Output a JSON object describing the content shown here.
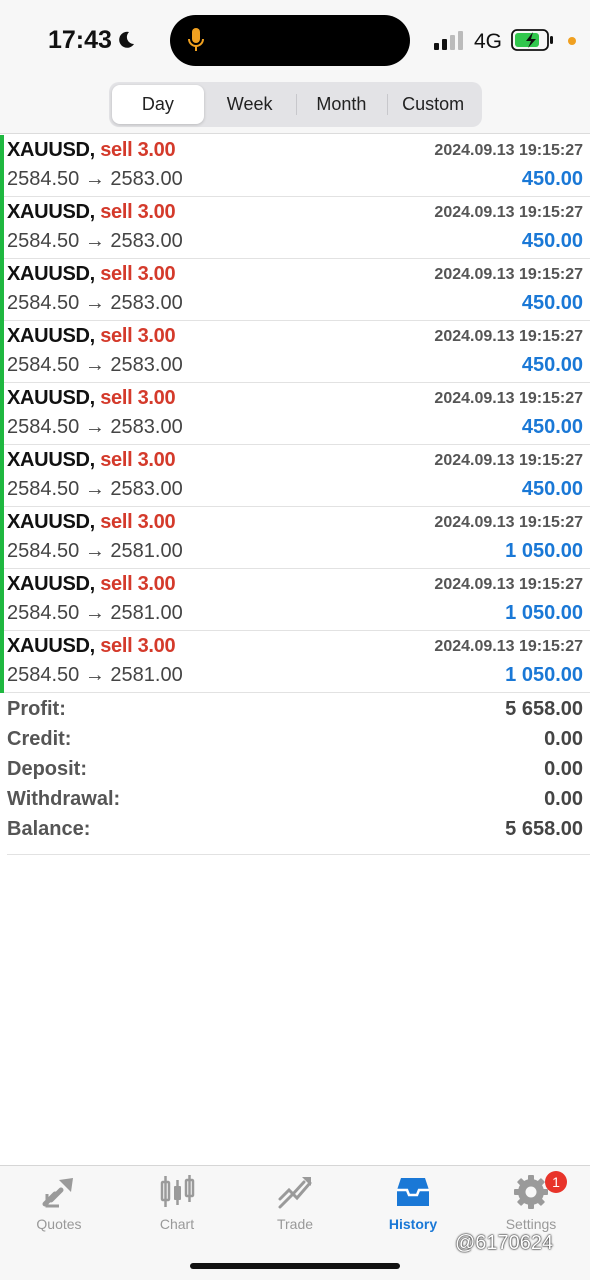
{
  "status": {
    "time": "17:43",
    "network": "4G"
  },
  "periods": [
    {
      "label": "Day",
      "active": true
    },
    {
      "label": "Week",
      "active": false
    },
    {
      "label": "Month",
      "active": false
    },
    {
      "label": "Custom",
      "active": false
    }
  ],
  "deals": [
    {
      "symbol": "XAUUSD,",
      "side": "sell 3.00",
      "time": "2024.09.13 19:15:27",
      "prices": "2584.50 → 2583.00",
      "profit": "450.00"
    },
    {
      "symbol": "XAUUSD,",
      "side": "sell 3.00",
      "time": "2024.09.13 19:15:27",
      "prices": "2584.50 → 2583.00",
      "profit": "450.00"
    },
    {
      "symbol": "XAUUSD,",
      "side": "sell 3.00",
      "time": "2024.09.13 19:15:27",
      "prices": "2584.50 → 2583.00",
      "profit": "450.00"
    },
    {
      "symbol": "XAUUSD,",
      "side": "sell 3.00",
      "time": "2024.09.13 19:15:27",
      "prices": "2584.50 → 2583.00",
      "profit": "450.00"
    },
    {
      "symbol": "XAUUSD,",
      "side": "sell 3.00",
      "time": "2024.09.13 19:15:27",
      "prices": "2584.50 → 2583.00",
      "profit": "450.00"
    },
    {
      "symbol": "XAUUSD,",
      "side": "sell 3.00",
      "time": "2024.09.13 19:15:27",
      "prices": "2584.50 → 2583.00",
      "profit": "450.00"
    },
    {
      "symbol": "XAUUSD,",
      "side": "sell 3.00",
      "time": "2024.09.13 19:15:27",
      "prices": "2584.50 → 2581.00",
      "profit": "1 050.00"
    },
    {
      "symbol": "XAUUSD,",
      "side": "sell 3.00",
      "time": "2024.09.13 19:15:27",
      "prices": "2584.50 → 2581.00",
      "profit": "1 050.00"
    },
    {
      "symbol": "XAUUSD,",
      "side": "sell 3.00",
      "time": "2024.09.13 19:15:27",
      "prices": "2584.50 → 2581.00",
      "profit": "1 050.00"
    }
  ],
  "summary": [
    {
      "label": "Profit:",
      "value": "5 658.00"
    },
    {
      "label": "Credit:",
      "value": "0.00"
    },
    {
      "label": "Deposit:",
      "value": "0.00"
    },
    {
      "label": "Withdrawal:",
      "value": "0.00"
    },
    {
      "label": "Balance:",
      "value": "5 658.00"
    }
  ],
  "tabs": [
    {
      "label": "Quotes",
      "icon": "quotes-icon",
      "active": false
    },
    {
      "label": "Chart",
      "icon": "chart-icon",
      "active": false
    },
    {
      "label": "Trade",
      "icon": "trade-icon",
      "active": false
    },
    {
      "label": "History",
      "icon": "history-icon",
      "active": true
    },
    {
      "label": "Settings",
      "icon": "settings-icon",
      "active": false,
      "badge": "1"
    }
  ],
  "watermark": "@6170624",
  "colors": {
    "sell": "#d43a2b",
    "profit": "#1a78d6",
    "bar": "#1fb840",
    "accent": "#1a78d6",
    "badge": "#e8342a"
  }
}
